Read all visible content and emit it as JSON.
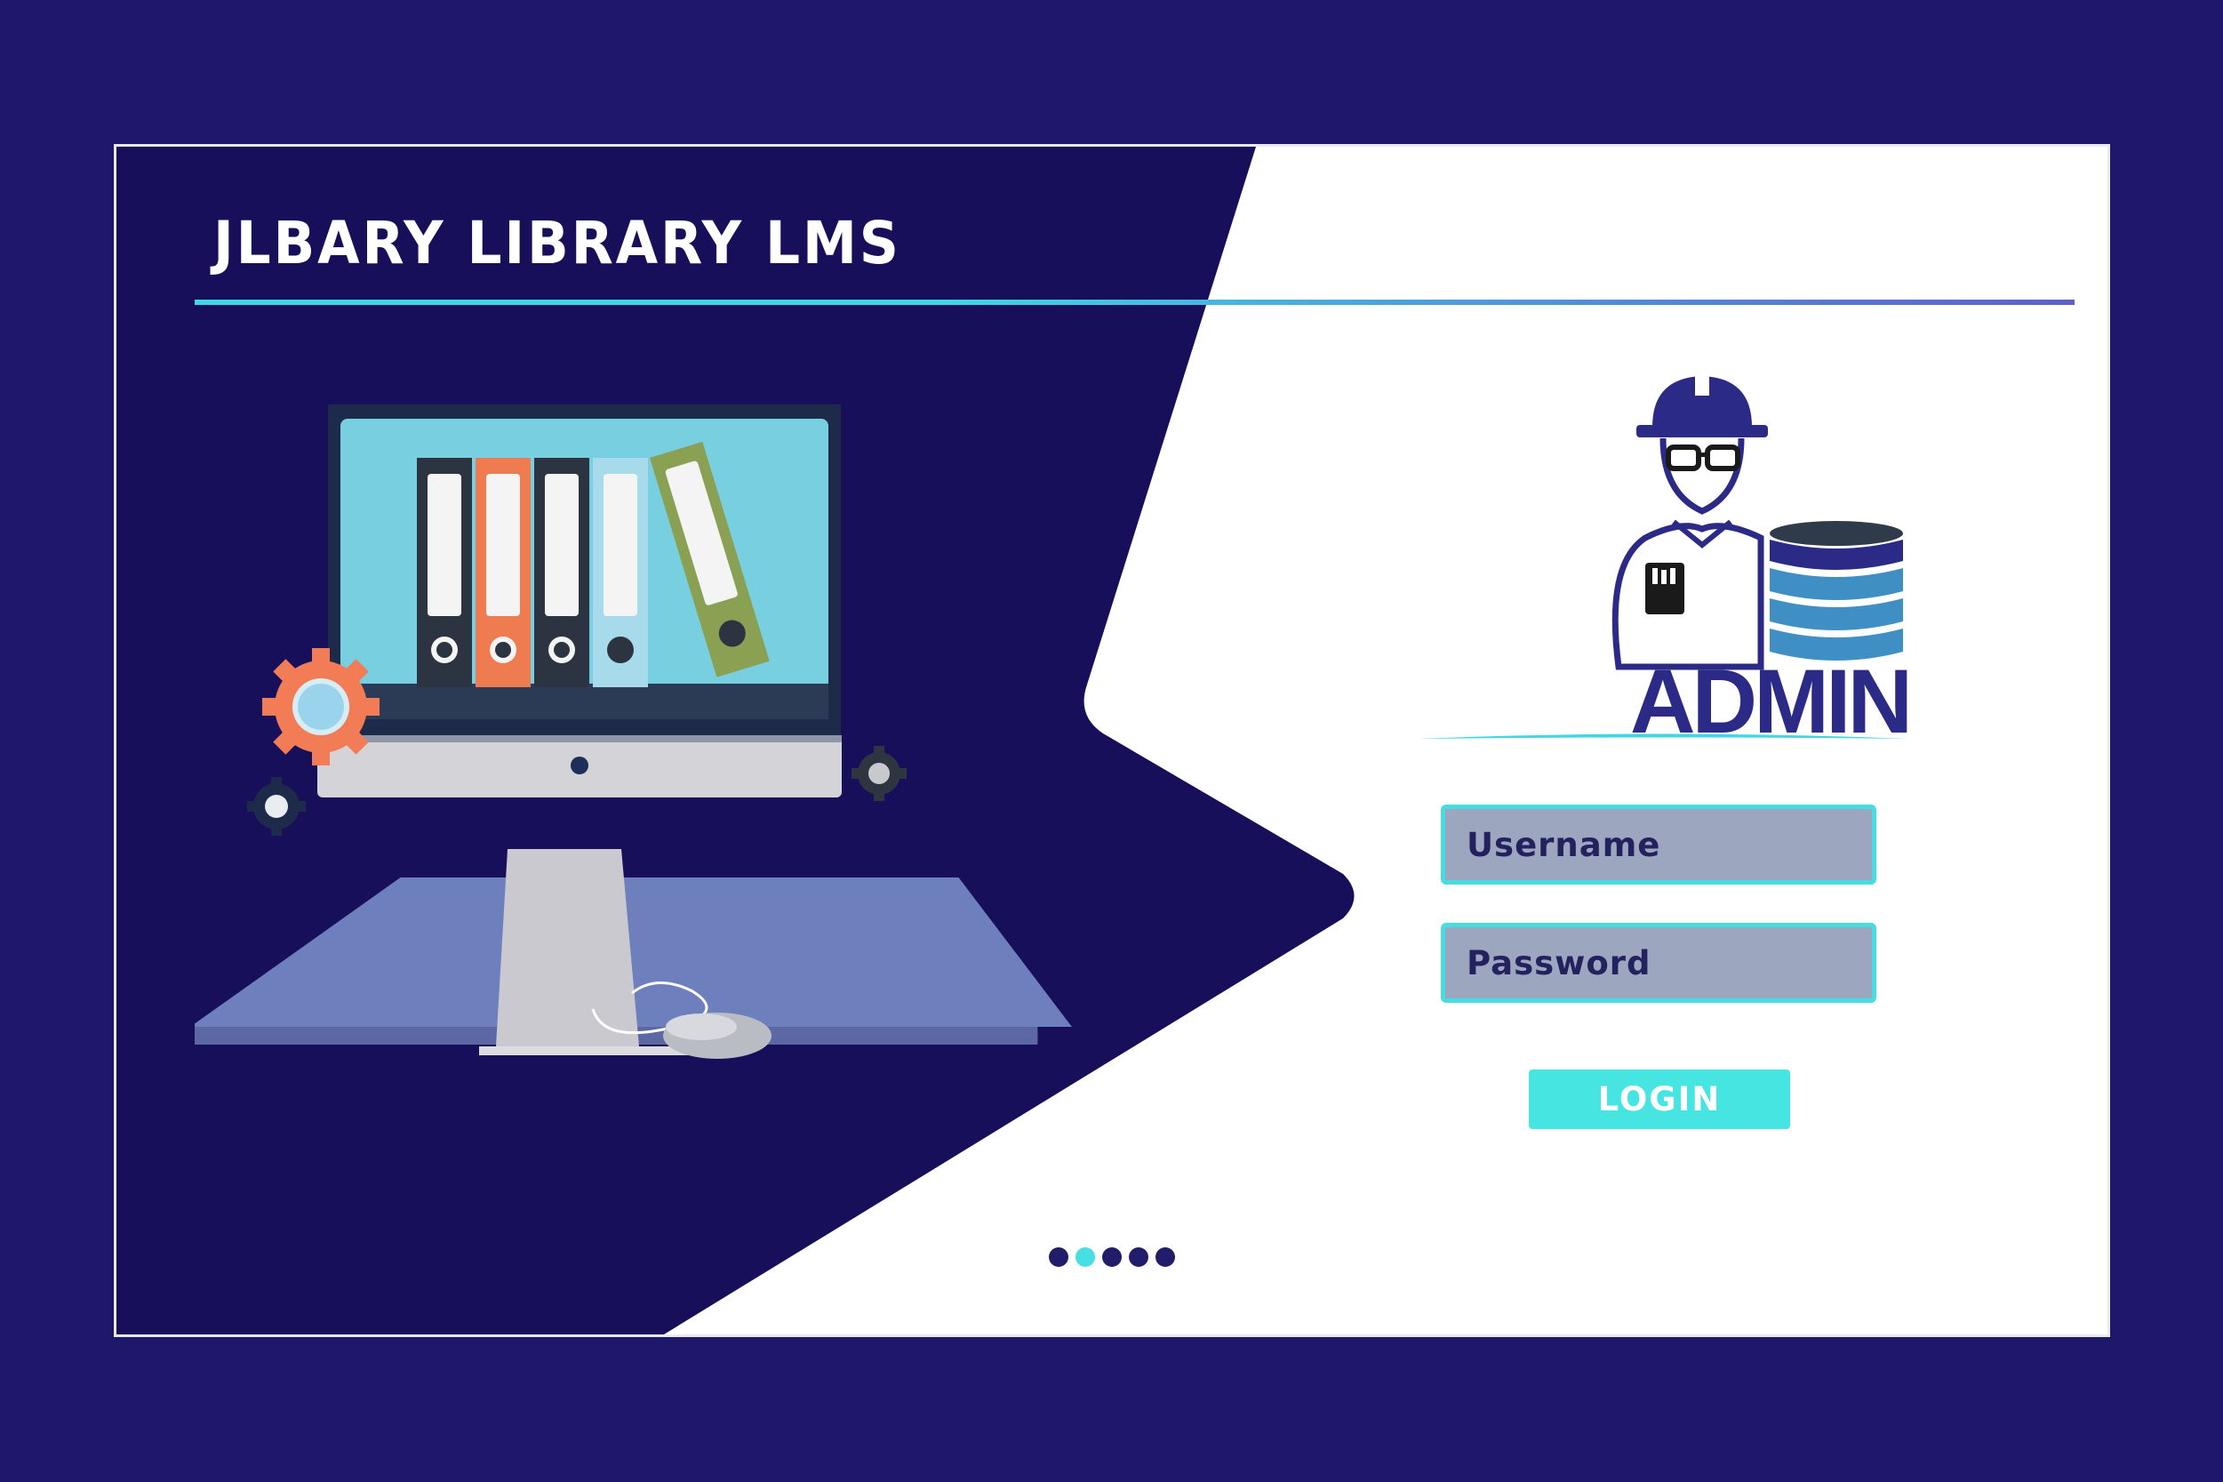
{
  "header": {
    "title": "JLBARY LIBRARY LMS"
  },
  "login": {
    "heading": "ADMIN",
    "username_placeholder": "Username",
    "password_placeholder": "Password",
    "login_label": "LOGIN"
  },
  "pager": {
    "count": 5,
    "active_index": 1
  },
  "icons": {
    "illustration": "computer-with-binders-icon",
    "admin_avatar": "admin-worker-with-database-icon",
    "gear": "gear-icon"
  },
  "colors": {
    "background": "#1f1769",
    "panel_dark": "#170f59",
    "accent": "#47e5e1",
    "input_fill": "#9ca6bf",
    "text_dark": "#24215f"
  }
}
